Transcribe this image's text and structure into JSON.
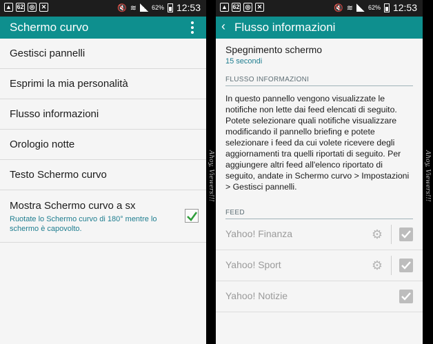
{
  "status": {
    "battery": "62%",
    "time": "12:53",
    "notif_badge": "62"
  },
  "left": {
    "title": "Schermo curvo",
    "items": [
      "Gestisci pannelli",
      "Esprimi la mia personalità",
      "Flusso informazioni",
      "Orologio notte",
      "Testo Schermo curvo"
    ],
    "toggle_item": {
      "label": "Mostra Schermo curvo a sx",
      "sub": "Ruotate lo Schermo curvo di 180° mentre lo schermo è capovolto.",
      "checked": true
    }
  },
  "right": {
    "title": "Flusso informazioni",
    "screen_off": {
      "label": "Spegnimento schermo",
      "value": "15 secondi"
    },
    "section_flusso": "FLUSSO INFORMAZIONI",
    "description": "In questo pannello vengono visualizzate le notifiche non lette dai feed elencati di seguito. Potete selezionare quali notifiche visualizzare modificando il pannello briefing e potete selezionare i feed da cui volete ricevere degli aggiornamenti tra quelli riportati di seguito. Per aggiungere altri feed all'elenco riportato di seguito, andate in Schermo curvo > Impostazioni > Gestisci pannelli.",
    "section_feed": "FEED",
    "feeds": [
      {
        "name": "Yahoo! Finanza",
        "checked": true
      },
      {
        "name": "Yahoo! Sport",
        "checked": true
      },
      {
        "name": "Yahoo! Notizie",
        "checked": true
      }
    ]
  },
  "watermark": "Ahoy, Viewers!!!",
  "colors": {
    "accent": "#0e8f8e",
    "statusbar": "#1d1d1d",
    "check_green": "#2e9e3a",
    "subtext": "#1e7d8f"
  }
}
